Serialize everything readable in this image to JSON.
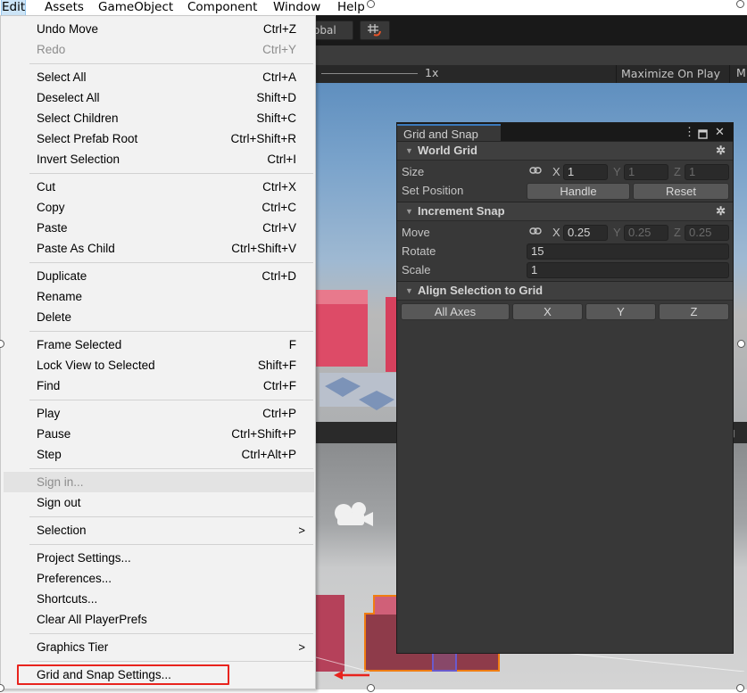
{
  "menubar": {
    "items": [
      "Edit",
      "Assets",
      "GameObject",
      "Component",
      "Window",
      "Help"
    ]
  },
  "toolbar": {
    "global_label": "obal"
  },
  "gameview": {
    "zoom_label": "1x",
    "maximize_label": "Maximize On Play",
    "trailing_label": "M"
  },
  "edit_menu": {
    "items": [
      {
        "label": "Undo Move",
        "shortcut": "Ctrl+Z"
      },
      {
        "label": "Redo",
        "shortcut": "Ctrl+Y"
      },
      {
        "label": "Select All",
        "shortcut": "Ctrl+A"
      },
      {
        "label": "Deselect All",
        "shortcut": "Shift+D"
      },
      {
        "label": "Select Children",
        "shortcut": "Shift+C"
      },
      {
        "label": "Select Prefab Root",
        "shortcut": "Ctrl+Shift+R"
      },
      {
        "label": "Invert Selection",
        "shortcut": "Ctrl+I"
      },
      {
        "label": "Cut",
        "shortcut": "Ctrl+X"
      },
      {
        "label": "Copy",
        "shortcut": "Ctrl+C"
      },
      {
        "label": "Paste",
        "shortcut": "Ctrl+V"
      },
      {
        "label": "Paste As Child",
        "shortcut": "Ctrl+Shift+V"
      },
      {
        "label": "Duplicate",
        "shortcut": "Ctrl+D"
      },
      {
        "label": "Rename",
        "shortcut": ""
      },
      {
        "label": "Delete",
        "shortcut": ""
      },
      {
        "label": "Frame Selected",
        "shortcut": "F"
      },
      {
        "label": "Lock View to Selected",
        "shortcut": "Shift+F"
      },
      {
        "label": "Find",
        "shortcut": "Ctrl+F"
      },
      {
        "label": "Play",
        "shortcut": "Ctrl+P"
      },
      {
        "label": "Pause",
        "shortcut": "Ctrl+Shift+P"
      },
      {
        "label": "Step",
        "shortcut": "Ctrl+Alt+P"
      },
      {
        "label": "Sign in...",
        "shortcut": ""
      },
      {
        "label": "Sign out",
        "shortcut": ""
      },
      {
        "label": "Selection",
        "shortcut": ">"
      },
      {
        "label": "Project Settings...",
        "shortcut": ""
      },
      {
        "label": "Preferences...",
        "shortcut": ""
      },
      {
        "label": "Shortcuts...",
        "shortcut": ""
      },
      {
        "label": "Clear All PlayerPrefs",
        "shortcut": ""
      },
      {
        "label": "Graphics Tier",
        "shortcut": ">"
      },
      {
        "label": "Grid and Snap Settings...",
        "shortcut": ""
      }
    ]
  },
  "grid_snap": {
    "tab_title": "Grid and Snap",
    "world_grid": {
      "title": "World Grid",
      "size_label": "Size",
      "size": {
        "x": "1",
        "y": "1",
        "z": "1"
      },
      "set_position_label": "Set Position",
      "handle_button": "Handle",
      "reset_button": "Reset"
    },
    "increment_snap": {
      "title": "Increment Snap",
      "move_label": "Move",
      "move": {
        "x": "0.25",
        "y": "0.25",
        "z": "0.25"
      },
      "rotate_label": "Rotate",
      "rotate_value": "15",
      "scale_label": "Scale",
      "scale_value": "1"
    },
    "align": {
      "title": "Align Selection to Grid",
      "all_axes": "All Axes",
      "x": "X",
      "y": "Y",
      "z": "Z"
    },
    "axis_labels": {
      "x": "X",
      "y": "Y",
      "z": "Z"
    }
  },
  "colors": {
    "highlight_box": "#e8231d",
    "tab_accent": "#3a79bb",
    "cube_pink": "#dd4b67"
  }
}
